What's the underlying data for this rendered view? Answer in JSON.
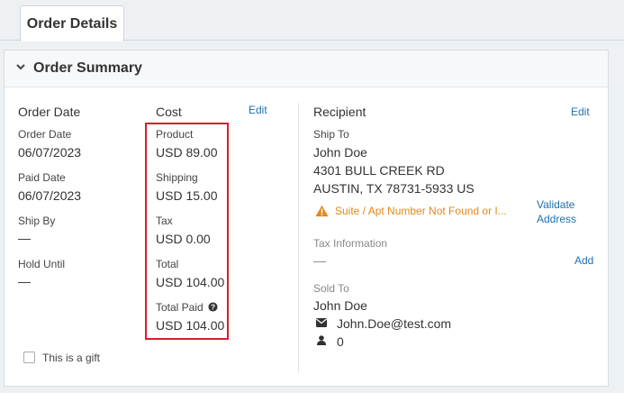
{
  "tabs": [
    {
      "label": "Order Details"
    }
  ],
  "panel": {
    "title": "Order Summary"
  },
  "order_date": {
    "heading": "Order Date",
    "order_date_label": "Order Date",
    "order_date_value": "06/07/2023",
    "paid_date_label": "Paid Date",
    "paid_date_value": "06/07/2023",
    "ship_by_label": "Ship By",
    "ship_by_value": "—",
    "hold_until_label": "Hold Until",
    "hold_until_value": "—"
  },
  "cost": {
    "heading": "Cost",
    "edit_label": "Edit",
    "product_label": "Product",
    "product_value": "USD 89.00",
    "shipping_label": "Shipping",
    "shipping_value": "USD 15.00",
    "tax_label": "Tax",
    "tax_value": "USD 0.00",
    "total_label": "Total",
    "total_value": "USD 104.00",
    "total_paid_label": "Total Paid",
    "total_paid_value": "USD 104.00"
  },
  "recipient": {
    "heading": "Recipient",
    "edit_label": "Edit",
    "ship_to_label": "Ship To",
    "name": "John Doe",
    "address_line1": "4301 BULL CREEK RD",
    "address_line2": "AUSTIN, TX 78731-5933 US",
    "warning": "Suite / Apt Number Not Found or I...",
    "validate_line1": "Validate",
    "validate_line2": "Address",
    "tax_info_label": "Tax Information",
    "tax_info_value": "—",
    "add_label": "Add",
    "sold_to_label": "Sold To",
    "sold_to_name": "John Doe",
    "sold_to_email": "John.Doe@test.com",
    "sold_to_count": "0"
  },
  "gift": {
    "label": "This is a gift",
    "checked": false
  },
  "colors": {
    "link": "#1f6fb2",
    "warning": "#e0891a",
    "highlight": "#d6202a"
  }
}
